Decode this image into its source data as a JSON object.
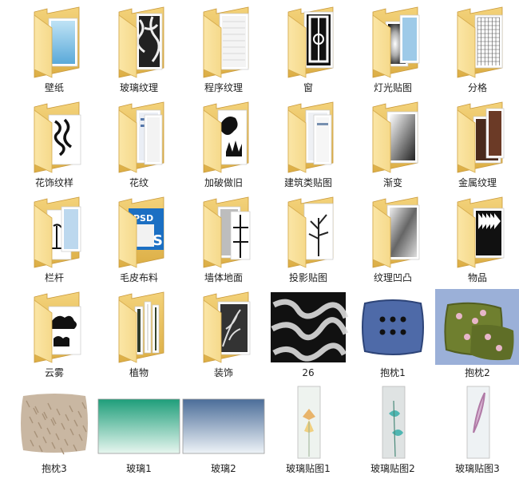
{
  "items": [
    {
      "label": "壁纸",
      "kind": "folder",
      "content": "sky"
    },
    {
      "label": "玻璃纹理",
      "kind": "folder",
      "content": "marble"
    },
    {
      "label": "程序纹理",
      "kind": "folder",
      "content": "doc"
    },
    {
      "label": "窗",
      "kind": "folder",
      "content": "window"
    },
    {
      "label": "灯光贴图",
      "kind": "folder",
      "content": "light"
    },
    {
      "label": "分格",
      "kind": "folder",
      "content": "grid"
    },
    {
      "label": "花饰纹样",
      "kind": "folder",
      "content": "dragon"
    },
    {
      "label": "花纹",
      "kind": "folder",
      "content": "docs"
    },
    {
      "label": "加破做旧",
      "kind": "folder",
      "content": "splat"
    },
    {
      "label": "建筑类贴图",
      "kind": "folder",
      "content": "docs2"
    },
    {
      "label": "渐变",
      "kind": "folder",
      "content": "gradient"
    },
    {
      "label": "金属纹理",
      "kind": "folder",
      "content": "metal"
    },
    {
      "label": "栏杆",
      "kind": "folder",
      "content": "rail"
    },
    {
      "label": "毛皮布料",
      "kind": "folder",
      "content": "psd"
    },
    {
      "label": "墙体地面",
      "kind": "folder",
      "content": "wall"
    },
    {
      "label": "投影贴图",
      "kind": "folder",
      "content": "tree"
    },
    {
      "label": "纹理凹凸",
      "kind": "folder",
      "content": "bump"
    },
    {
      "label": "物品",
      "kind": "folder",
      "content": "items"
    },
    {
      "label": "云雾",
      "kind": "folder",
      "content": "cloud"
    },
    {
      "label": "植物",
      "kind": "folder",
      "content": "plant"
    },
    {
      "label": "装饰",
      "kind": "folder",
      "content": "deco"
    },
    {
      "label": "26",
      "kind": "image",
      "content": "marble-image"
    },
    {
      "label": "抱枕1",
      "kind": "image",
      "content": "pillow-blue"
    },
    {
      "label": "抱枕2",
      "kind": "image",
      "content": "pillow-green"
    },
    {
      "label": "抱枕3",
      "kind": "image",
      "content": "pillow-fur"
    },
    {
      "label": "玻璃1",
      "kind": "image",
      "content": "glass-green"
    },
    {
      "label": "玻璃2",
      "kind": "image",
      "content": "glass-blue"
    },
    {
      "label": "玻璃贴图1",
      "kind": "image",
      "content": "glass-flower1"
    },
    {
      "label": "玻璃贴图2",
      "kind": "image",
      "content": "glass-flower2"
    },
    {
      "label": "玻璃贴图3",
      "kind": "image",
      "content": "glass-feather"
    }
  ],
  "colors": {
    "folder_back": "#e9c25d",
    "folder_front": "#f8e29b",
    "label": "#1e1e1e"
  }
}
